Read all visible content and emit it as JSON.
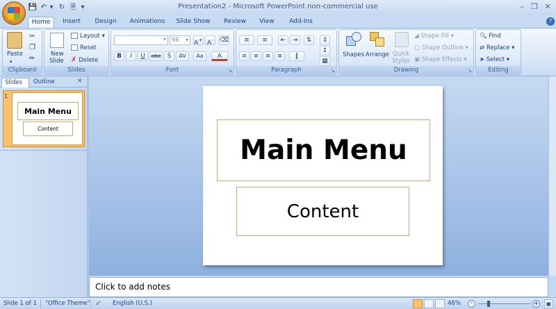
{
  "window": {
    "title": "Presentation2 - Microsoft PowerPoint non-commercial use"
  },
  "tabs": [
    "Home",
    "Insert",
    "Design",
    "Animations",
    "Slide Show",
    "Review",
    "View",
    "Add-Ins"
  ],
  "ribbon": {
    "clipboard": {
      "paste": "Paste",
      "label": "Clipboard"
    },
    "slides": {
      "new_slide_line1": "New",
      "new_slide_line2": "Slide",
      "layout": "Layout",
      "reset": "Reset",
      "delete": "Delete",
      "label": "Slides"
    },
    "font": {
      "size": "66",
      "label": "Font"
    },
    "paragraph": {
      "label": "Paragraph"
    },
    "drawing": {
      "shapes": "Shapes",
      "arrange": "Arrange",
      "quick_styles_line1": "Quick",
      "quick_styles_line2": "Styles",
      "shape_fill": "Shape Fill",
      "shape_outline": "Shape Outline",
      "shape_effects": "Shape Effects",
      "label": "Drawing"
    },
    "editing": {
      "find": "Find",
      "replace": "Replace",
      "select": "Select",
      "label": "Editing"
    }
  },
  "left_pane": {
    "tabs": [
      "Slides",
      "Outline"
    ],
    "slide_number": "1",
    "thumb_title": "Main Menu",
    "thumb_content": "Content"
  },
  "slide": {
    "title": "Main Menu",
    "content": "Content"
  },
  "notes": {
    "placeholder": "Click to add notes"
  },
  "status": {
    "slide": "Slide 1 of 1",
    "theme": "\"Office Theme\"",
    "language": "English (U.S.)",
    "zoom": "46%"
  },
  "colors": {
    "accent": "#15428b",
    "ribbon_bg": "#dde9f8",
    "placeholder_border": "#d9a46a"
  }
}
